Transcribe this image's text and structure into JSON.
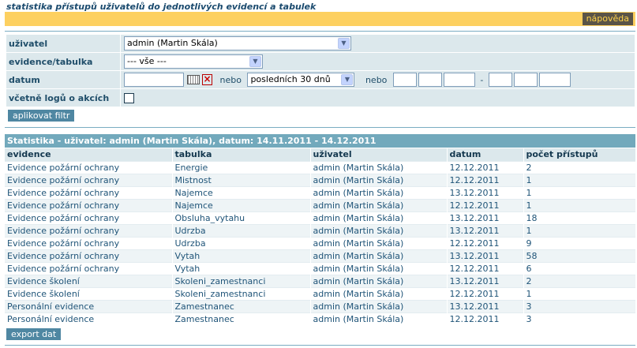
{
  "page_title": "statistika přístupů uživatelů do jednotlivých evidencí a tabulek",
  "help_label": "nápověda",
  "filter": {
    "rows": [
      {
        "label": "uživatel"
      },
      {
        "label": "evidence/tabulka"
      },
      {
        "label": "datum"
      },
      {
        "label": "včetně logů o akcích"
      }
    ],
    "user_value": "admin (Martin Skála)",
    "evidence_value": "--- vše ---",
    "date_value": "",
    "nebo1": "nebo",
    "period_value": "posledních 30 dnů",
    "nebo2": "nebo",
    "range_separator": "-",
    "include_logs_checked": false,
    "apply_label": "aplikovat filtr"
  },
  "stats": {
    "heading": "Statistika - uživatel: admin (Martin Skála), datum: 14.11.2011 - 14.12.2011",
    "columns": [
      "evidence",
      "tabulka",
      "uživatel",
      "datum",
      "počet přístupů"
    ],
    "rows": [
      [
        "Evidence požární ochrany",
        "Energie",
        "admin (Martin Skála)",
        "12.12.2011",
        "2"
      ],
      [
        "Evidence požární ochrany",
        "Mistnost",
        "admin (Martin Skála)",
        "12.12.2011",
        "1"
      ],
      [
        "Evidence požární ochrany",
        "Najemce",
        "admin (Martin Skála)",
        "13.12.2011",
        "1"
      ],
      [
        "Evidence požární ochrany",
        "Najemce",
        "admin (Martin Skála)",
        "12.12.2011",
        "1"
      ],
      [
        "Evidence požární ochrany",
        "Obsluha_vytahu",
        "admin (Martin Skála)",
        "13.12.2011",
        "18"
      ],
      [
        "Evidence požární ochrany",
        "Udrzba",
        "admin (Martin Skála)",
        "13.12.2011",
        "1"
      ],
      [
        "Evidence požární ochrany",
        "Udrzba",
        "admin (Martin Skála)",
        "12.12.2011",
        "9"
      ],
      [
        "Evidence požární ochrany",
        "Vytah",
        "admin (Martin Skála)",
        "13.12.2011",
        "58"
      ],
      [
        "Evidence požární ochrany",
        "Vytah",
        "admin (Martin Skála)",
        "12.12.2011",
        "6"
      ],
      [
        "Evidence školení",
        "Skoleni_zamestnanci",
        "admin (Martin Skála)",
        "13.12.2011",
        "2"
      ],
      [
        "Evidence školení",
        "Skoleni_zamestnanci",
        "admin (Martin Skála)",
        "12.12.2011",
        "1"
      ],
      [
        "Personální evidence",
        "Zamestnanec",
        "admin (Martin Skála)",
        "13.12.2011",
        "3"
      ],
      [
        "Personální evidence",
        "Zamestnanec",
        "admin (Martin Skála)",
        "12.12.2011",
        "3"
      ]
    ],
    "export_label": "export dat"
  },
  "colors": {
    "title": "#1a4a6e",
    "topbar": "#fdd060",
    "help_bg": "#5a5447",
    "help_text": "#ffd24a",
    "label_bg": "#dce8ec",
    "heading_bg": "#72a9bc",
    "button_bg": "#4f87a2"
  },
  "icons": {
    "calendar": "calendar-icon",
    "clear_date": "clear-date-icon",
    "dropdown": "chevron-down-icon"
  }
}
